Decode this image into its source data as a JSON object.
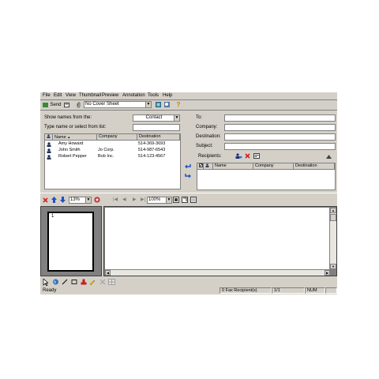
{
  "menu": [
    "File",
    "Edit",
    "View",
    "Thumbnail",
    "Preview",
    "Annotation",
    "Tools",
    "Help"
  ],
  "toolbar": {
    "send_label": "Send",
    "cover_sheet": "No Cover Sheet"
  },
  "left": {
    "show_names_label": "Show names from the:",
    "show_names_value": "Contact",
    "type_name_label": "Type name or select from list:",
    "columns": [
      "Name",
      "Company",
      "Destination"
    ],
    "contacts": [
      {
        "name": "Amy Howard",
        "company": "",
        "destination": "514-369-3693"
      },
      {
        "name": "John Smith",
        "company": "Jo Corp.",
        "destination": "514-987-6543"
      },
      {
        "name": "Robert Pepper",
        "company": "Bob Inc.",
        "destination": "514-123-4567"
      }
    ]
  },
  "right": {
    "to_label": "To:",
    "company_label": "Company:",
    "destination_label": "Destination:",
    "subject_label": "Subject:",
    "recipients_label": "Recipients:",
    "columns": [
      "Name",
      "Company",
      "Destination"
    ]
  },
  "viewer": {
    "zoom_thumb": "13%",
    "zoom_page": "100%",
    "page_number": "1"
  },
  "status": {
    "ready": "Ready",
    "recipients": "0 Fax Recipient(s)",
    "page": "1/1",
    "num": "NUM"
  }
}
